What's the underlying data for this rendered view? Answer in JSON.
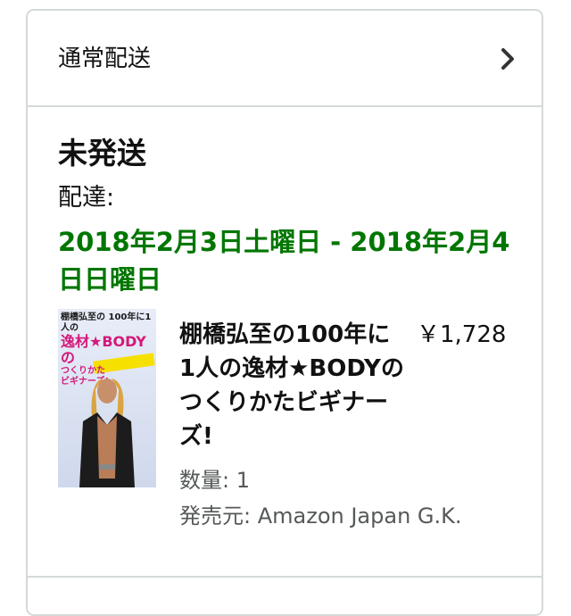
{
  "shipping": {
    "label": "通常配送"
  },
  "shipment": {
    "status": "未発送",
    "delivery_label": "配達:",
    "delivery_date": "2018年2月3日土曜日 - 2018年2月4日日曜日"
  },
  "item": {
    "title": "棚橋弘至の100年に1人の逸材★BODYのつくりかたビギナーズ!",
    "price": "￥1,728",
    "quantity": "数量: 1",
    "seller": "発売元: Amazon Japan G.K.",
    "cover": {
      "line1": "棚橋弘至の 100年に1人の",
      "line2": "逸材★BODYの",
      "line3": "つくりかた",
      "line4": "ビギナーズ!"
    }
  },
  "colors": {
    "delivery_green": "#007600",
    "border": "#d5d9d9",
    "secondary_text": "#565959"
  },
  "icons": {
    "chevron": "chevron-right-icon"
  }
}
